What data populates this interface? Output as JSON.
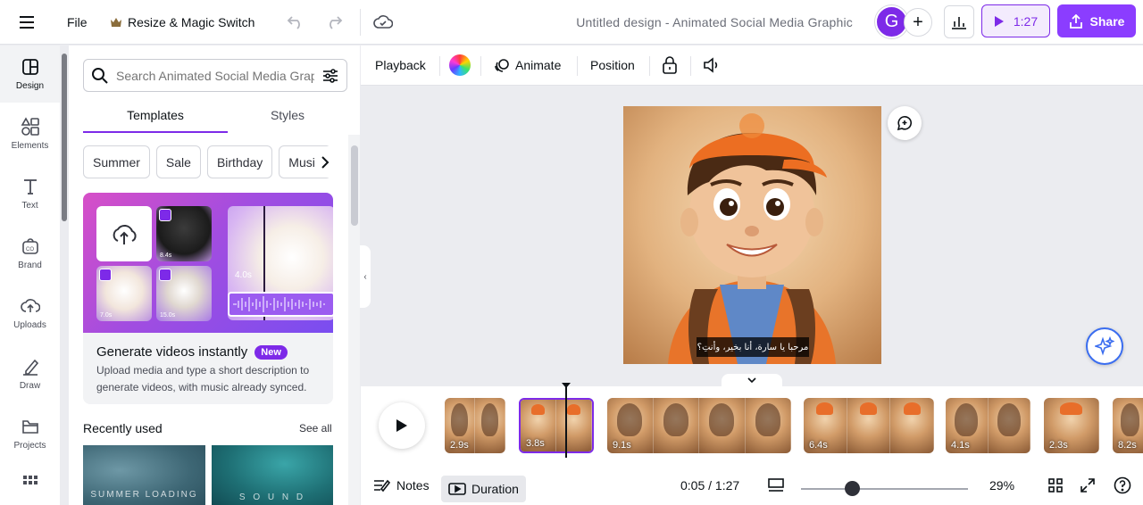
{
  "topbar": {
    "file_label": "File",
    "resize_label": "Resize & Magic Switch",
    "resize_icon": "crown-icon",
    "title": "Untitled design - Animated Social Media Graphic",
    "avatar_initial": "G",
    "play_label": "1:27",
    "share_label": "Share",
    "accent": "#7d2ae8"
  },
  "rail": {
    "items": [
      {
        "label": "Design",
        "icon": "design-icon"
      },
      {
        "label": "Elements",
        "icon": "elements-icon"
      },
      {
        "label": "Text",
        "icon": "text-icon"
      },
      {
        "label": "Brand",
        "icon": "brand-icon"
      },
      {
        "label": "Uploads",
        "icon": "uploads-icon"
      },
      {
        "label": "Draw",
        "icon": "draw-icon"
      },
      {
        "label": "Projects",
        "icon": "projects-icon"
      }
    ]
  },
  "panel": {
    "search_placeholder": "Search Animated Social Media Graphic",
    "tabs": [
      "Templates",
      "Styles"
    ],
    "chips": [
      "Summer",
      "Sale",
      "Birthday",
      "Music"
    ],
    "promo": {
      "title": "Generate videos instantly",
      "badge": "New",
      "description": "Upload media and type a short description to generate videos, with music already synced.",
      "art_labels": [
        "8.4s",
        "7.0s",
        "15.0s",
        "4.0s"
      ]
    },
    "recent_heading": "Recently used",
    "see_all": "See all",
    "recent": [
      "SUMMER LOADING",
      "S O U N D"
    ]
  },
  "context_toolbar": {
    "playback": "Playback",
    "animate": "Animate",
    "position": "Position"
  },
  "canvas": {
    "caption": "مرحبا يا سارة، أنا بخير، وأنتِ؟"
  },
  "timeline": {
    "clips": [
      {
        "duration": "2.9s",
        "frames": [
          "girl",
          "girl"
        ],
        "selected": false
      },
      {
        "duration": "3.8s",
        "frames": [
          "boy",
          "boy"
        ],
        "selected": true
      },
      {
        "duration": "9.1s",
        "frames": [
          "girl",
          "girl",
          "girl",
          "girl"
        ],
        "selected": false
      },
      {
        "duration": "6.4s",
        "frames": [
          "boy",
          "boy",
          "boy"
        ],
        "selected": false
      },
      {
        "duration": "4.1s",
        "frames": [
          "girl",
          "girl"
        ],
        "selected": false
      },
      {
        "duration": "2.3s",
        "frames": [
          "boy"
        ],
        "selected": false
      },
      {
        "duration": "8.2s",
        "frames": [
          "girl"
        ],
        "selected": false
      }
    ]
  },
  "bottombar": {
    "notes": "Notes",
    "duration": "Duration",
    "time": "0:05 / 1:27",
    "zoom_percent": "29%",
    "zoom_level": 0.29
  }
}
